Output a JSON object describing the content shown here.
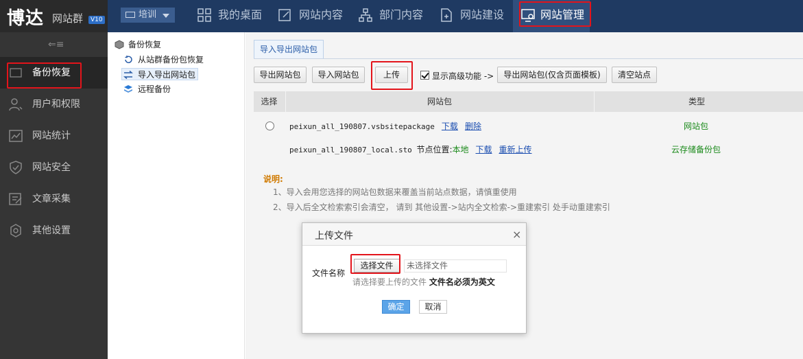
{
  "brand": {
    "name": "博达",
    "product": "网站群",
    "version": "V10"
  },
  "site_selector": {
    "value": "培训"
  },
  "nav": [
    {
      "label": "我的桌面",
      "icon": "grid-icon"
    },
    {
      "label": "网站内容",
      "icon": "edit-icon"
    },
    {
      "label": "部门内容",
      "icon": "org-icon"
    },
    {
      "label": "网站建设",
      "icon": "build-icon"
    },
    {
      "label": "网站管理",
      "icon": "manage-icon",
      "active": true
    }
  ],
  "sidebar": {
    "items": [
      {
        "label": "备份恢复",
        "icon": "backup-icon",
        "active": true
      },
      {
        "label": "用户和权限",
        "icon": "user-icon"
      },
      {
        "label": "网站统计",
        "icon": "chart-icon"
      },
      {
        "label": "网站安全",
        "icon": "shield-icon"
      },
      {
        "label": "文章采集",
        "icon": "collect-icon"
      },
      {
        "label": "其他设置",
        "icon": "gear-icon"
      }
    ]
  },
  "tree": {
    "root": "备份恢复",
    "children": [
      "从站群备份包恢复",
      "导入导出网站包",
      "远程备份"
    ]
  },
  "tab": {
    "label": "导入导出网站包"
  },
  "toolbar": {
    "export": "导出网站包",
    "import": "导入网站包",
    "upload": "上传",
    "advanced": "显示高级功能 ->",
    "export_template": "导出网站包(仅含页面模板)",
    "clear": "清空站点"
  },
  "table": {
    "headers": [
      "选择",
      "网站包",
      "类型"
    ],
    "rows": [
      {
        "file": "peixun_all_190807.vsbsitepackage",
        "links": [
          "下载",
          "删除"
        ],
        "type": "网站包"
      },
      {
        "file": "peixun_all_190807_local.sto",
        "node_label": "节点位置:",
        "node_value": "本地",
        "links": [
          "下载",
          "重新上传"
        ],
        "type": "云存储备份包"
      }
    ]
  },
  "notes": {
    "title": "说明:",
    "lines": [
      "1、导入会用您选择的网站包数据来覆盖当前站点数据，请慎重使用",
      "2、导入后全文检索索引会清空，  请到 其他设置->站内全文检索->重建索引 处手动重建索引"
    ]
  },
  "modal": {
    "title": "上传文件",
    "close": "×",
    "field_label": "文件名称",
    "choose": "选择文件",
    "no_file": "未选择文件",
    "hint": "请选择要上传的文件",
    "hint_bold": "文件名必须为英文",
    "ok": "确定",
    "cancel": "取消"
  },
  "colors": {
    "topbar": "#1f3a62",
    "sidebar": "#353535",
    "highlight": "#e3141b",
    "primary": "#5ba4e8"
  }
}
